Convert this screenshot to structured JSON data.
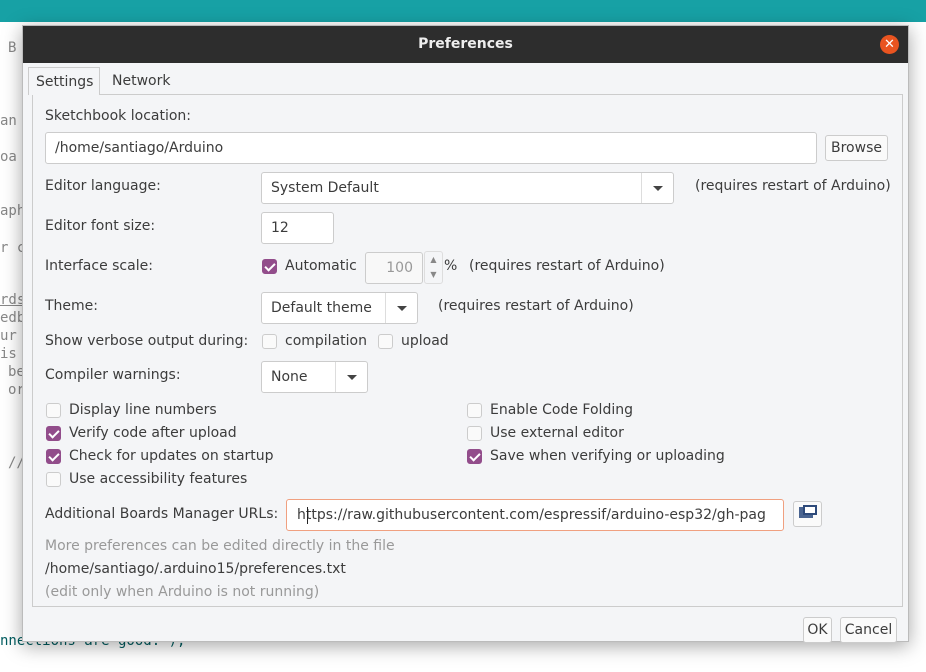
{
  "background": {
    "fragments": [
      "B",
      "an",
      "oa",
      "aph",
      "r c",
      "rds",
      "edb",
      "ur",
      "is",
      "be",
      "or",
      "//",
      "nnections are good.\");"
    ]
  },
  "dialog": {
    "title": "Preferences",
    "close_icon": "close-icon"
  },
  "tabs": [
    {
      "label": "Settings",
      "active": true
    },
    {
      "label": "Network",
      "active": false
    }
  ],
  "settings": {
    "sketchbook_label": "Sketchbook location:",
    "sketchbook_value": "/home/santiago/Arduino",
    "browse": "Browse",
    "language_label": "Editor language:",
    "language_value": "System Default",
    "restart_note": "(requires restart of Arduino)",
    "fontsize_label": "Editor font size:",
    "fontsize_value": "12",
    "scale_label": "Interface scale:",
    "scale_auto": "Automatic",
    "scale_auto_checked": true,
    "scale_value": "100",
    "scale_unit": "%",
    "theme_label": "Theme:",
    "theme_value": "Default theme",
    "verbose_label": "Show verbose output during:",
    "verbose_compilation": "compilation",
    "verbose_upload": "upload",
    "warnings_label": "Compiler warnings:",
    "warnings_value": "None",
    "checkboxes": [
      {
        "label": "Display line numbers",
        "checked": false
      },
      {
        "label": "Verify code after upload",
        "checked": true
      },
      {
        "label": "Check for updates on startup",
        "checked": true
      },
      {
        "label": "Use accessibility features",
        "checked": false
      },
      {
        "label": "Enable Code Folding",
        "checked": false
      },
      {
        "label": "Use external editor",
        "checked": false
      },
      {
        "label": "Save when verifying or uploading",
        "checked": true
      }
    ],
    "boards_label": "Additional Boards Manager URLs:",
    "boards_value": "https://raw.githubusercontent.com/espressif/arduino-esp32/gh-pag",
    "more_note": "More preferences can be edited directly in the file",
    "prefs_path": "/home/santiago/.arduino15/preferences.txt",
    "edit_note": "(edit only when Arduino is not running)"
  },
  "footer": {
    "ok": "OK",
    "cancel": "Cancel"
  },
  "colors": {
    "accent": "#924d8b",
    "titlebar": "#2d2d2d",
    "close": "#e95420",
    "topbar": "#17a1a5",
    "focus": "#f0a080"
  }
}
